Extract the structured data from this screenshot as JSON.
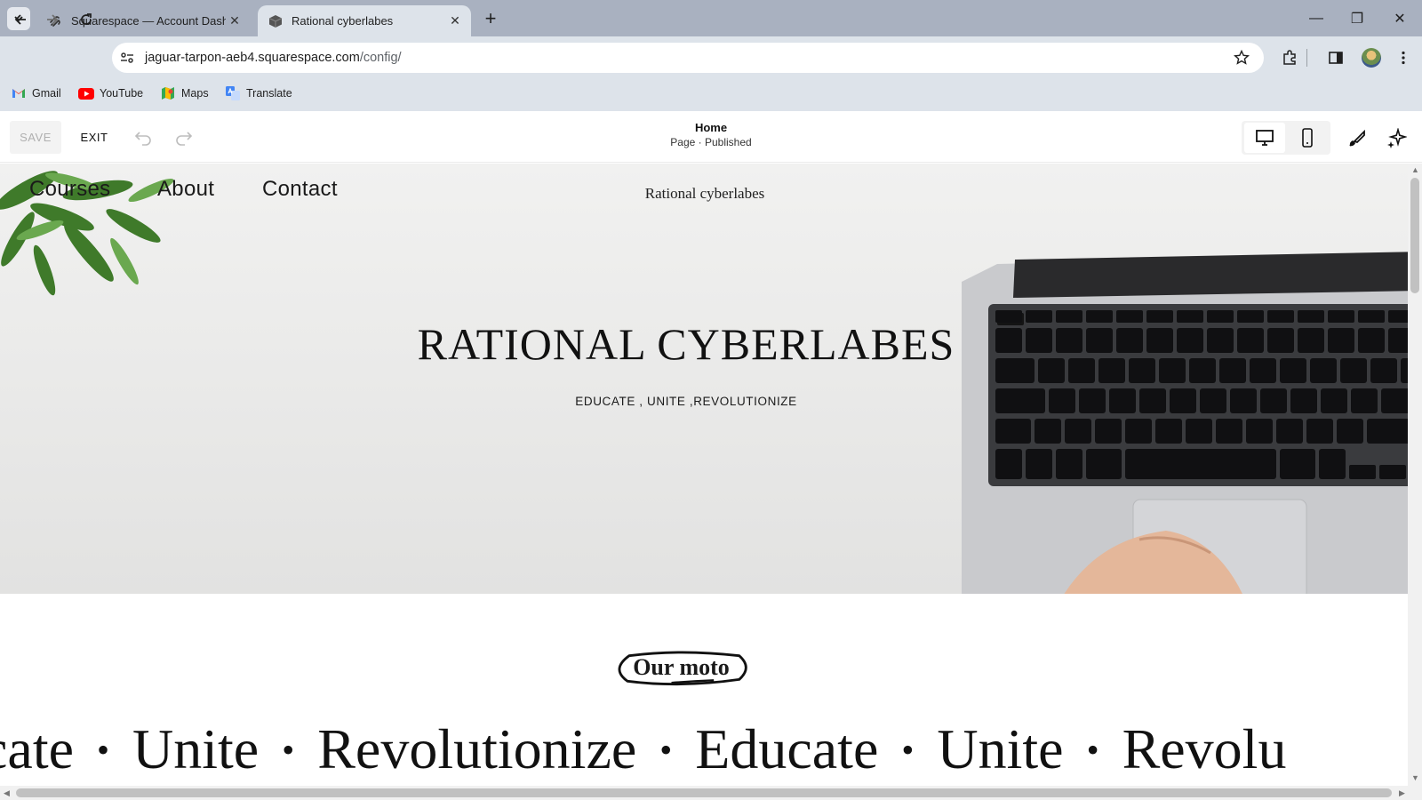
{
  "browser": {
    "tabs": [
      {
        "title": "Squarespace — Account Dashb",
        "favicon": "squarespace-icon",
        "active": false
      },
      {
        "title": "Rational cyberlabes",
        "favicon": "cube-icon",
        "active": true
      }
    ],
    "close_glyph": "✕",
    "new_tab_glyph": "+",
    "window_controls": {
      "minimize": "—",
      "restore": "❐",
      "close": "✕"
    },
    "url_domain": "jaguar-tarpon-aeb4.squarespace.com",
    "url_path": "/config/",
    "bookmarks": [
      {
        "label": "Gmail",
        "icon": "gmail-icon"
      },
      {
        "label": "YouTube",
        "icon": "youtube-icon"
      },
      {
        "label": "Maps",
        "icon": "maps-icon"
      },
      {
        "label": "Translate",
        "icon": "translate-icon"
      }
    ],
    "colors": {
      "tabbar": "#a9b1c0",
      "toolbar": "#dde3ea"
    }
  },
  "editor": {
    "save_label": "SAVE",
    "exit_label": "EXIT",
    "page_name": "Home",
    "page_status": "Page · Published",
    "device_view": "desktop"
  },
  "site": {
    "nav": [
      "Courses",
      "About",
      "Contact"
    ],
    "title": "Rational cyberlabes",
    "hero_heading": "RATIONAL CYBERLABES",
    "hero_subheading": "EDUCATE , UNITE ,REVOLUTIONIZE",
    "moto_heading": "Our moto",
    "marquee": [
      "cate",
      "Unite",
      "Revolutionize",
      "Educate",
      "Unite",
      "Revolu"
    ],
    "marquee_separator": "•"
  }
}
